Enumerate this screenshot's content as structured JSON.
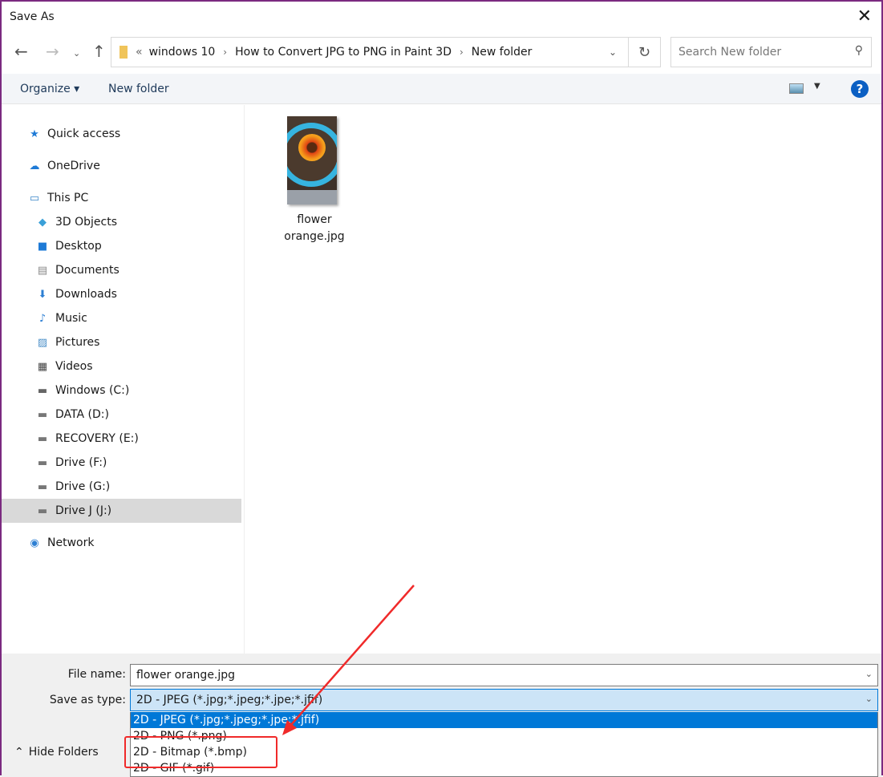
{
  "window": {
    "title": "Save As",
    "close_icon": "close-icon"
  },
  "address": {
    "path": [
      "windows 10",
      "How to Convert JPG to PNG in Paint 3D",
      "New folder"
    ],
    "overflow": "«"
  },
  "search": {
    "placeholder": "Search New folder"
  },
  "toolbar": {
    "organize": "Organize ▾",
    "new_folder": "New folder",
    "help": "?"
  },
  "nav": {
    "items": [
      {
        "label": "Quick access",
        "icon": "★",
        "color": "#1e7ad6"
      },
      {
        "label": "OneDrive",
        "icon": "☁",
        "color": "#1e7ad6"
      },
      {
        "label": "This PC",
        "icon": "▭",
        "color": "#3a86c8"
      },
      {
        "label": "3D Objects",
        "icon": "◆",
        "color": "#3aa0d8"
      },
      {
        "label": "Desktop",
        "icon": "■",
        "color": "#1e7ad6"
      },
      {
        "label": "Documents",
        "icon": "▤",
        "color": "#888"
      },
      {
        "label": "Downloads",
        "icon": "⬇",
        "color": "#2d7fd3"
      },
      {
        "label": "Music",
        "icon": "♪",
        "color": "#2d7fd3"
      },
      {
        "label": "Pictures",
        "icon": "▨",
        "color": "#4a8fc8"
      },
      {
        "label": "Videos",
        "icon": "▦",
        "color": "#444"
      },
      {
        "label": "Windows (C:)",
        "icon": "▬",
        "color": "#666"
      },
      {
        "label": "DATA (D:)",
        "icon": "▬",
        "color": "#777"
      },
      {
        "label": "RECOVERY (E:)",
        "icon": "▬",
        "color": "#777"
      },
      {
        "label": "Drive (F:)",
        "icon": "▬",
        "color": "#777"
      },
      {
        "label": "Drive (G:)",
        "icon": "▬",
        "color": "#777"
      },
      {
        "label": "Drive J (J:)",
        "icon": "▬",
        "color": "#777",
        "selected": true
      },
      {
        "label": "Network",
        "icon": "◉",
        "color": "#2d7fd3"
      }
    ]
  },
  "files": [
    {
      "name_line1": "flower",
      "name_line2": "orange.jpg"
    }
  ],
  "form": {
    "file_name_label": "File name:",
    "file_name_value": "flower orange.jpg",
    "type_label": "Save as type:",
    "type_value": "2D - JPEG (*.jpg;*.jpeg;*.jpe;*.jfif)",
    "options": [
      "2D - JPEG (*.jpg;*.jpeg;*.jpe;*.jfif)",
      "2D - PNG (*.png)",
      "2D - Bitmap (*.bmp)",
      "2D - GIF (*.gif)"
    ]
  },
  "hide_folders": "Hide Folders",
  "colors": {
    "accent": "#0078d7",
    "annotation": "#f02a2a",
    "border": "#7b2a80"
  }
}
